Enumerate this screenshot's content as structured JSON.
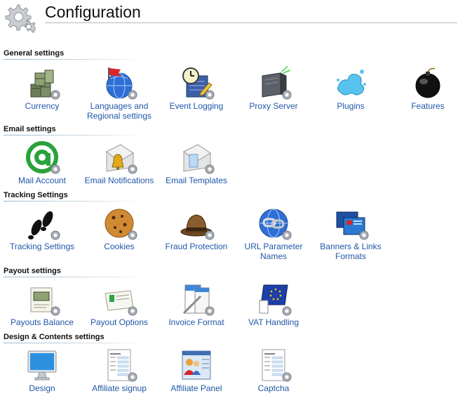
{
  "page": {
    "title": "Configuration"
  },
  "sections": [
    {
      "title": "General settings",
      "items": [
        {
          "label": "Currency",
          "icon": "currency-icon"
        },
        {
          "label": "Languages and\nRegional settings",
          "icon": "globe-flag-icon"
        },
        {
          "label": "Event Logging",
          "icon": "clock-pencil-icon"
        },
        {
          "label": "Proxy Server",
          "icon": "server-icon"
        },
        {
          "label": "Plugins",
          "icon": "puzzle-splash-icon"
        },
        {
          "label": "Features",
          "icon": "bomb-icon"
        }
      ]
    },
    {
      "title": "Email settings",
      "items": [
        {
          "label": "Mail Account",
          "icon": "at-sign-icon"
        },
        {
          "label": "Email Notifications",
          "icon": "envelope-bell-icon"
        },
        {
          "label": "Email Templates",
          "icon": "envelope-template-icon"
        }
      ]
    },
    {
      "title": "Tracking Settings",
      "items": [
        {
          "label": "Tracking Settings",
          "icon": "footprints-icon"
        },
        {
          "label": "Cookies",
          "icon": "cookie-icon"
        },
        {
          "label": "Fraud Protection",
          "icon": "detective-hat-icon"
        },
        {
          "label": "URL Parameter\nNames",
          "icon": "globe-link-icon"
        },
        {
          "label": "Banners & Links\nFormats",
          "icon": "banners-icon"
        }
      ]
    },
    {
      "title": "Payout settings",
      "items": [
        {
          "label": "Payouts Balance",
          "icon": "money-balance-icon"
        },
        {
          "label": "Payout Options",
          "icon": "payout-card-icon"
        },
        {
          "label": "Invoice Format",
          "icon": "invoice-pen-icon"
        },
        {
          "label": "VAT Handling",
          "icon": "eu-flag-icon"
        }
      ]
    },
    {
      "title": "Design & Contents settings",
      "items": [
        {
          "label": "Design",
          "icon": "monitor-icon"
        },
        {
          "label": "Affiliate signup",
          "icon": "signup-form-icon"
        },
        {
          "label": "Affiliate Panel",
          "icon": "affiliate-panel-icon"
        },
        {
          "label": "Captcha",
          "icon": "captcha-form-icon"
        }
      ]
    }
  ],
  "colors": {
    "link": "#1f57a8",
    "section_line": "#9bb6c9",
    "title_line": "#b5b5b5"
  }
}
